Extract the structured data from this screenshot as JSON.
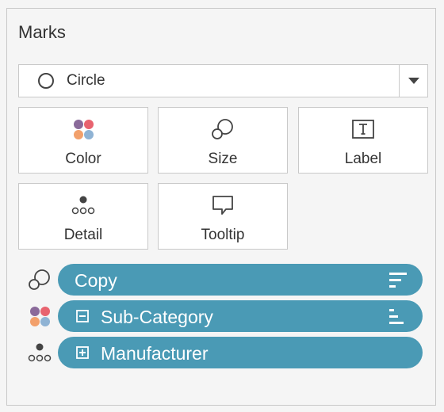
{
  "marks": {
    "title": "Marks",
    "mark_type": {
      "label": "Circle",
      "icon": "circle-outline-icon"
    },
    "cards": [
      {
        "label": "Color",
        "icon": "color-dots-icon"
      },
      {
        "label": "Size",
        "icon": "size-circles-icon"
      },
      {
        "label": "Label",
        "icon": "label-text-icon"
      },
      {
        "label": "Detail",
        "icon": "detail-dots-icon"
      },
      {
        "label": "Tooltip",
        "icon": "tooltip-bubble-icon"
      }
    ],
    "pills": [
      {
        "label": "Copy",
        "role": "size",
        "sort": true
      },
      {
        "label": "Sub-Category",
        "role": "color",
        "expand": "collapse",
        "sort": true
      },
      {
        "label": "Manufacturer",
        "role": "detail",
        "expand": "expand"
      }
    ],
    "colors": {
      "pill": "#4a9ab5",
      "dot_purple": "#8a6a9a",
      "dot_red": "#e8636f",
      "dot_orange": "#f2a06b",
      "dot_blue": "#8fb3d4"
    }
  }
}
